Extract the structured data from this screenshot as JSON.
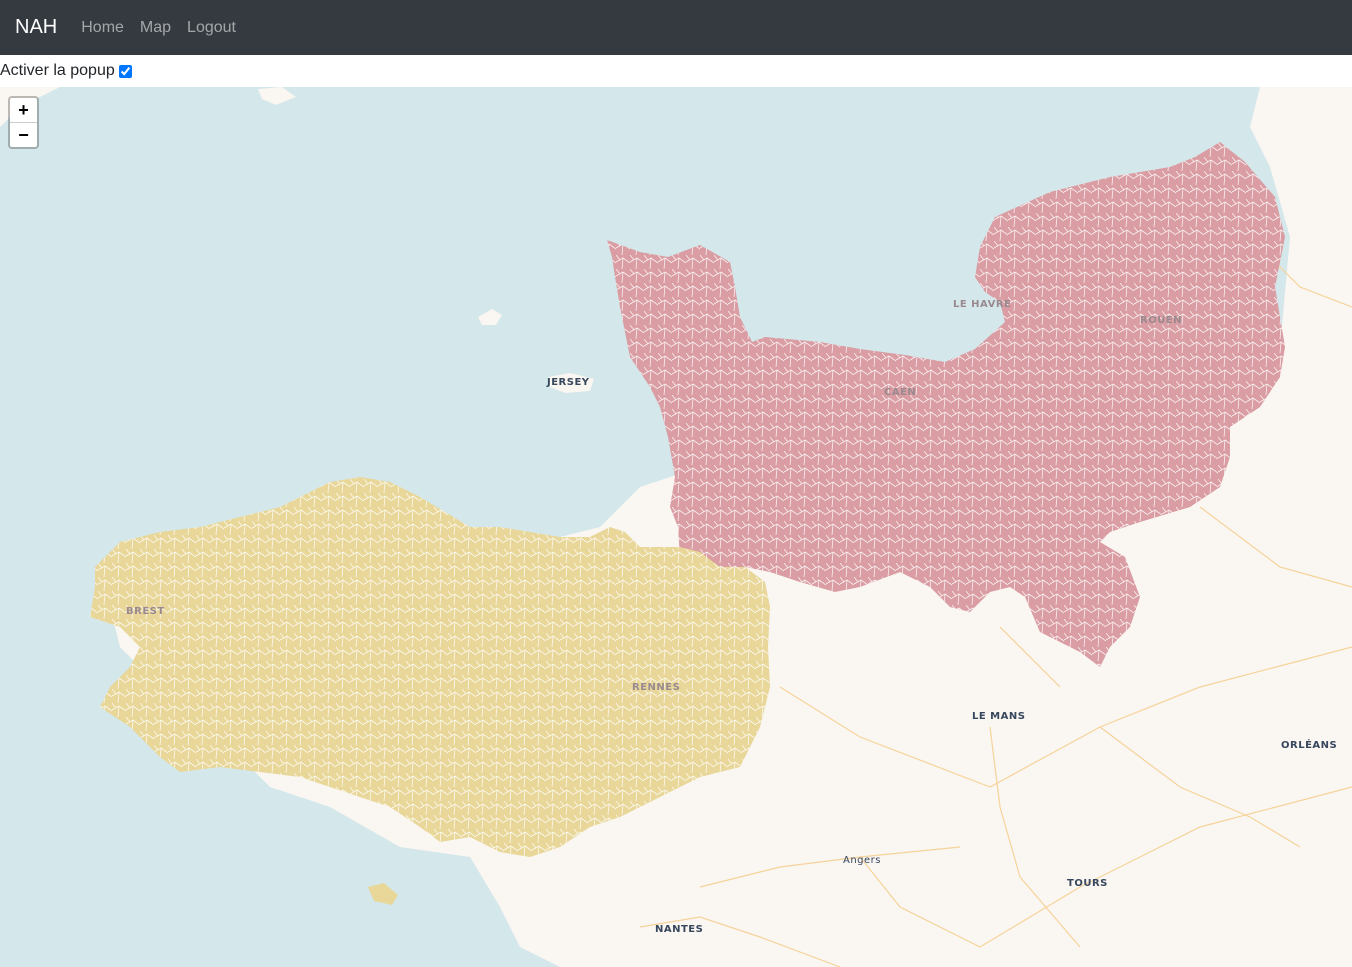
{
  "navbar": {
    "brand": "NAH",
    "links": [
      "Home",
      "Map",
      "Logout"
    ]
  },
  "popup_toggle": {
    "label": "Activer la popup",
    "checked": true
  },
  "map": {
    "zoom_in": "+",
    "zoom_out": "−",
    "colors": {
      "sea": "#d4e7ea",
      "land": "#faf6f1",
      "normandie": "#d99da3",
      "bretagne": "#e8d799",
      "roads": "#f6d39a"
    },
    "labels": {
      "jersey": "JERSEY",
      "le_havre": "LE HAVRE",
      "rouen": "ROUEN",
      "caen": "CAEN",
      "brest": "BREST",
      "rennes": "RENNES",
      "le_mans": "LE MANS",
      "orleans": "ORLÉANS",
      "angers": "Angers",
      "tours": "TOURS",
      "nantes": "NANTES"
    },
    "regions": [
      "Normandie",
      "Bretagne"
    ]
  }
}
